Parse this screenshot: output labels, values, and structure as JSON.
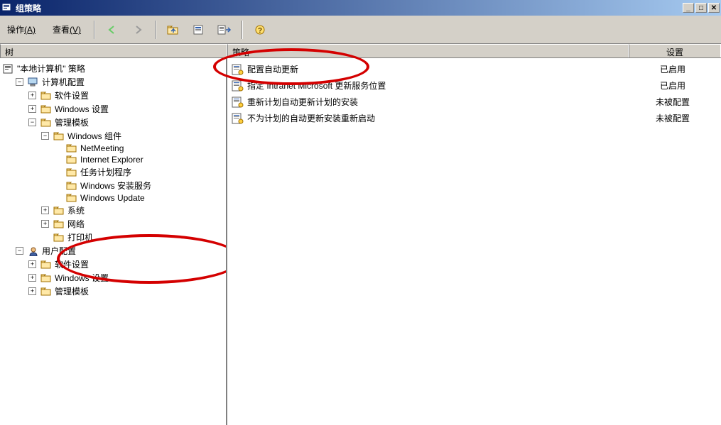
{
  "window": {
    "title": "组策略"
  },
  "menubar": {
    "action_label": "操作",
    "action_hotkey": "(A)",
    "view_label": "查看",
    "view_hotkey": "(V)"
  },
  "columns": {
    "tree": "树",
    "policy": "策略",
    "setting": "设置"
  },
  "tree": {
    "root_label": "\"本地计算机\" 策略",
    "computer_config": "计算机配置",
    "software_settings": "软件设置",
    "windows_settings": "Windows 设置",
    "admin_templates": "管理模板",
    "windows_components": "Windows 组件",
    "netmeeting": "NetMeeting",
    "ie": "Internet Explorer",
    "task_scheduler": "任务计划程序",
    "windows_installer": "Windows 安装服务",
    "windows_update": "Windows Update",
    "system": "系统",
    "network": "网络",
    "printers": "打印机",
    "user_config": "用户配置",
    "software_settings2": "软件设置",
    "windows_settings2": "Windows 设置",
    "admin_templates2": "管理模板"
  },
  "policies": [
    {
      "name": "配置自动更新",
      "setting": "已启用"
    },
    {
      "name": "指定 Intranet Microsoft 更新服务位置",
      "setting": "已启用"
    },
    {
      "name": "重新计划自动更新计划的安装",
      "setting": "未被配置"
    },
    {
      "name": "不为计划的自动更新安装重新启动",
      "setting": "未被配置"
    }
  ]
}
